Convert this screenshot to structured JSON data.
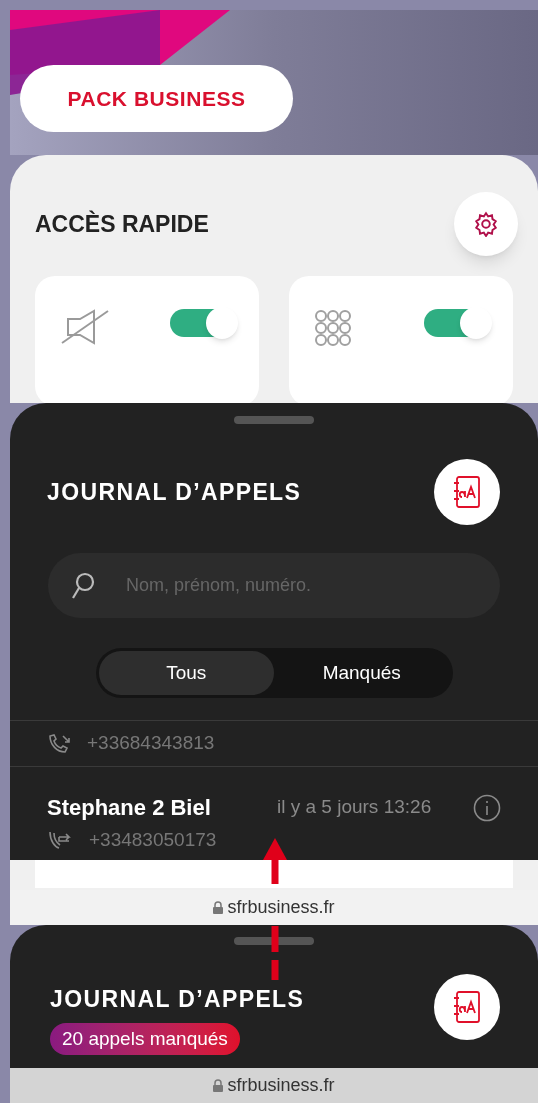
{
  "header": {
    "button": "PACK BUSINESS"
  },
  "quick_access": {
    "title": "ACCÈS RAPIDE",
    "tiles": [
      {
        "kind": "mute",
        "on": true
      },
      {
        "kind": "grid",
        "on": true
      }
    ]
  },
  "call_log": {
    "title": "JOURNAL D’APPELS",
    "search": {
      "placeholder": "Nom, prénom, numéro."
    },
    "filters": [
      {
        "label": "Tous",
        "selected": true
      },
      {
        "label": "Manqués",
        "selected": false
      }
    ],
    "calls": [
      {
        "number": "+33684343813",
        "kind": "incoming"
      },
      {
        "name": "Stephane 2 Biel",
        "time": "il y a 5 jours 13:26",
        "number": "+33483050173",
        "kind": "outgoing"
      }
    ]
  },
  "url_bar": "sfrbusiness.fr",
  "collapsed_log": {
    "title": "JOURNAL D’APPELS",
    "badge": "20 appels manqués"
  },
  "bottom_url_bar": "sfrbusiness.fr"
}
